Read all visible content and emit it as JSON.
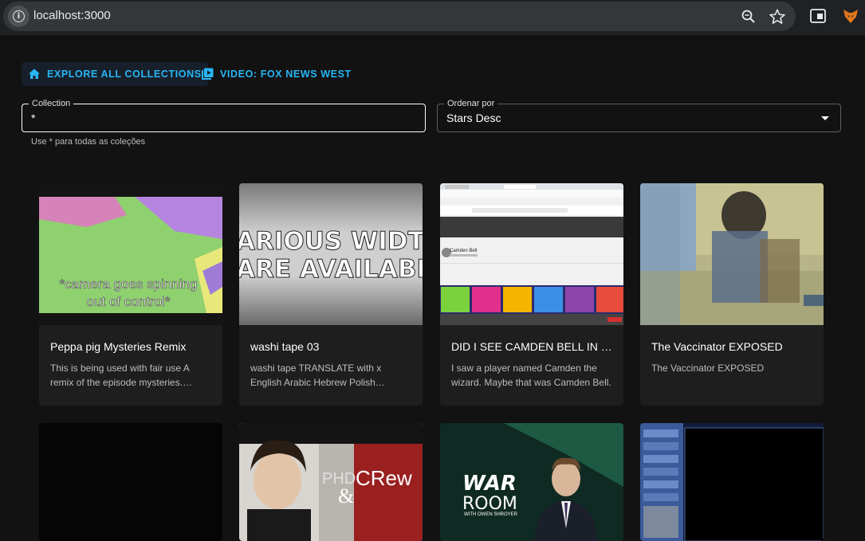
{
  "browser": {
    "url": "localhost:3000",
    "icons": [
      "info-icon",
      "zoom-icon",
      "star-icon",
      "side-panel-icon",
      "extension-icon"
    ]
  },
  "nav": {
    "explore_label": "EXPLORE ALL COLLECTIONS",
    "video_label": "VIDEO: FOX NEWS WEST",
    "accent_color": "#29b6f6"
  },
  "filters": {
    "collection_label": "Collection",
    "collection_value": "*",
    "collection_helper": "Use * para todas as coleções",
    "order_label": "Ordenar por",
    "order_value": "Stars Desc"
  },
  "cards": [
    {
      "title": "Peppa pig Mysteries Remix",
      "description": "This is being used with fair use A remix of the episode mysteries. Peppa pig and friends",
      "thumb_caption": "*camera goes spinning out of control*"
    },
    {
      "title": "washi tape 03",
      "description": "washi tape  TRANSLATE with x English Arabic Hebrew Polish Bulgarian",
      "thumb_caption": "ARIOUS WIDTH ARE AVAILABLE"
    },
    {
      "title": "DID I SEE CAMDEN BELL IN PRODIGY?",
      "description": "I saw a player named Camden the wizard. Maybe that was Camden Bell.",
      "thumb_caption": "Camden Bell"
    },
    {
      "title": "The Vaccinator EXPOSED",
      "description": "The Vaccinator EXPOSED",
      "thumb_caption": ""
    },
    {
      "title": "",
      "description": "",
      "thumb_caption": ""
    },
    {
      "title": "",
      "description": "",
      "thumb_caption": "PHD CRew &"
    },
    {
      "title": "",
      "description": "",
      "thumb_caption": "WAR ROOM WITH OWEN SHROYER"
    },
    {
      "title": "",
      "description": "",
      "thumb_caption": ""
    }
  ]
}
